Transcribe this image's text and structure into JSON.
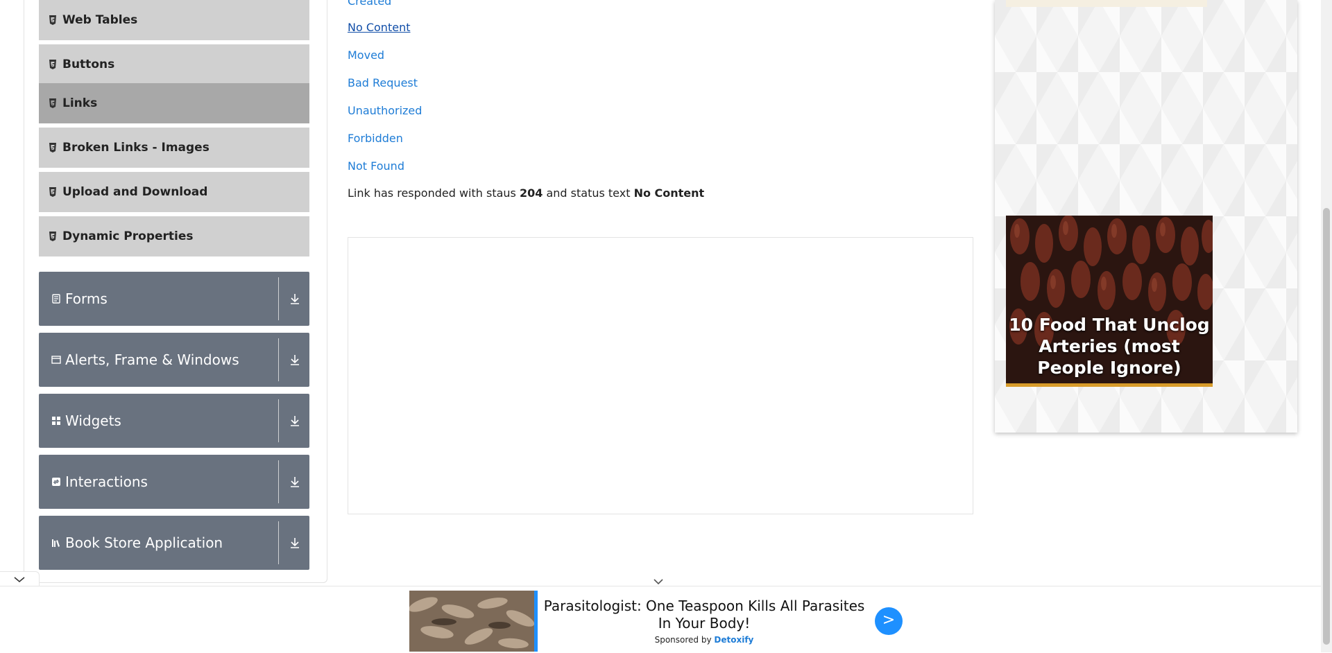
{
  "sidebar": {
    "elements_items": [
      {
        "label": "Web Tables",
        "active": false
      },
      {
        "label": "Buttons",
        "active": false
      },
      {
        "label": "Links",
        "active": true
      },
      {
        "label": "Broken Links - Images",
        "active": false
      },
      {
        "label": "Upload and Download",
        "active": false
      },
      {
        "label": "Dynamic Properties",
        "active": false
      }
    ],
    "groups": [
      {
        "label": "Forms",
        "icon": "form-icon"
      },
      {
        "label": "Alerts, Frame & Windows",
        "icon": "window-icon"
      },
      {
        "label": "Widgets",
        "icon": "widgets-icon"
      },
      {
        "label": "Interactions",
        "icon": "interactions-icon"
      },
      {
        "label": "Book Store Application",
        "icon": "books-icon"
      }
    ]
  },
  "main": {
    "links": [
      "Created",
      "No Content",
      "Moved",
      "Bad Request",
      "Unauthorized",
      "Forbidden",
      "Not Found"
    ],
    "response": {
      "prefix": "Link has responded with staus",
      "status_code": "204",
      "middle": "and status text",
      "status_text": "No Content"
    }
  },
  "right_ad": {
    "text": "10 Food That Unclog Arteries (most People Ignore)"
  },
  "bottom_ad": {
    "headline": "Parasitologist: One Teaspoon Kills All Parasites In Your Body!",
    "sponsored_by": "Sponsored by",
    "brand": "Detoxify",
    "go_label": ">"
  },
  "colors": {
    "link": "#1e7cd6",
    "group_bg": "#69727f",
    "item_bg": "#d0d0d0",
    "active_item_bg": "#a8a8a8",
    "cta": "#1e90ff"
  }
}
